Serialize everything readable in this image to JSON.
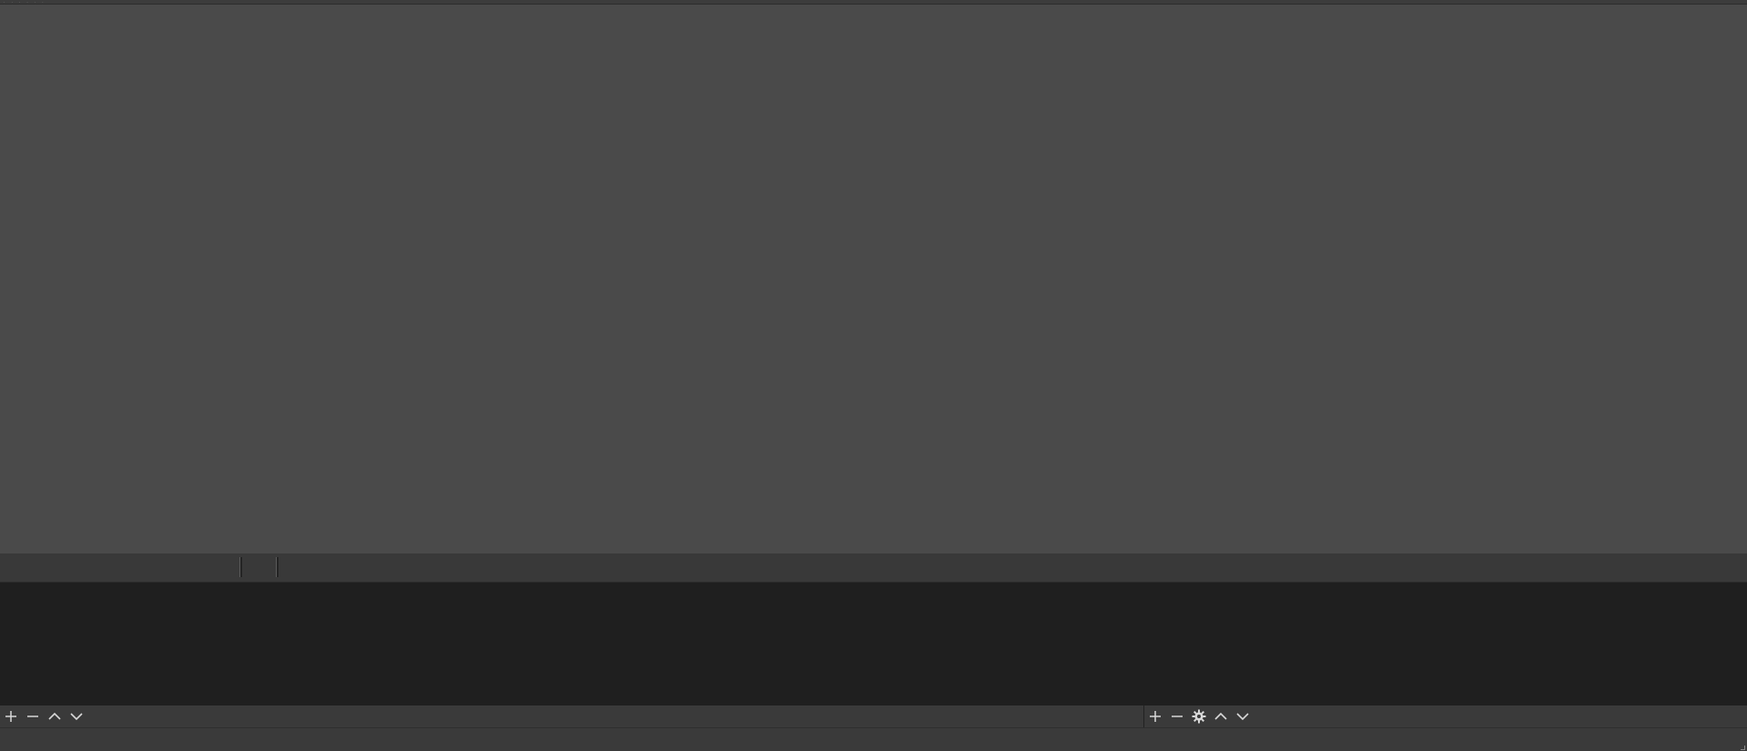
{
  "menubar": {
    "grip_dots": "· · · · · ·"
  },
  "scenes_toolbar": {
    "buttons": [
      {
        "icon": "plus-icon"
      },
      {
        "icon": "minus-icon"
      },
      {
        "icon": "chevron-up-icon"
      },
      {
        "icon": "chevron-down-icon"
      }
    ]
  },
  "sources_toolbar": {
    "buttons": [
      {
        "icon": "plus-icon"
      },
      {
        "icon": "minus-icon"
      },
      {
        "icon": "gear-icon"
      },
      {
        "icon": "chevron-up-icon"
      },
      {
        "icon": "chevron-down-icon"
      }
    ]
  },
  "colors": {
    "preview_bg": "#4a4a4a",
    "dock_bg": "#1f1f1f",
    "toolbar_bg": "#3a3a3a",
    "icon": "#d8d8d8"
  }
}
